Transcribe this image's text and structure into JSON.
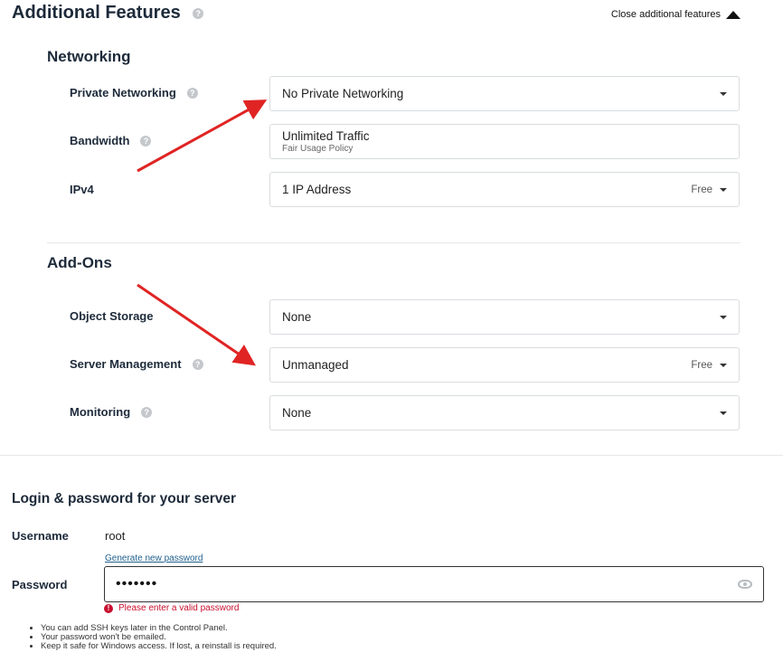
{
  "header": {
    "title": "Additional Features",
    "close_label": "Close additional features"
  },
  "networking": {
    "title": "Networking",
    "rows": [
      {
        "label": "Private Networking",
        "value": "No Private Networking"
      },
      {
        "label": "Bandwidth",
        "value": "Unlimited Traffic",
        "subtext": "Fair Usage Policy"
      },
      {
        "label": "IPv4",
        "value": "1 IP Address",
        "price": "Free"
      }
    ]
  },
  "addons": {
    "title": "Add-Ons",
    "rows": [
      {
        "label": "Object Storage",
        "value": "None"
      },
      {
        "label": "Server Management",
        "value": "Unmanaged",
        "price": "Free"
      },
      {
        "label": "Monitoring",
        "value": "None"
      }
    ]
  },
  "login": {
    "title": "Login & password for your server",
    "username_label": "Username",
    "username_value": "root",
    "generate_link": "Generate new password",
    "password_label": "Password",
    "password_value": "•••••••",
    "error": "Please enter a valid password",
    "notes": [
      "You can add SSH keys later in the Control Panel.",
      "Your password won't be emailed.",
      "Keep it safe for Windows access. If lost, a reinstall is required."
    ]
  },
  "colors": {
    "annotation_arrow": "#e02424",
    "error": "#c8102e",
    "link": "#1f5f8c"
  },
  "icons": {
    "help": "question-circle-icon",
    "caret": "caret-down-icon",
    "collapse": "caret-up-icon",
    "reveal": "eye-icon",
    "error": "alert-circle-icon"
  }
}
